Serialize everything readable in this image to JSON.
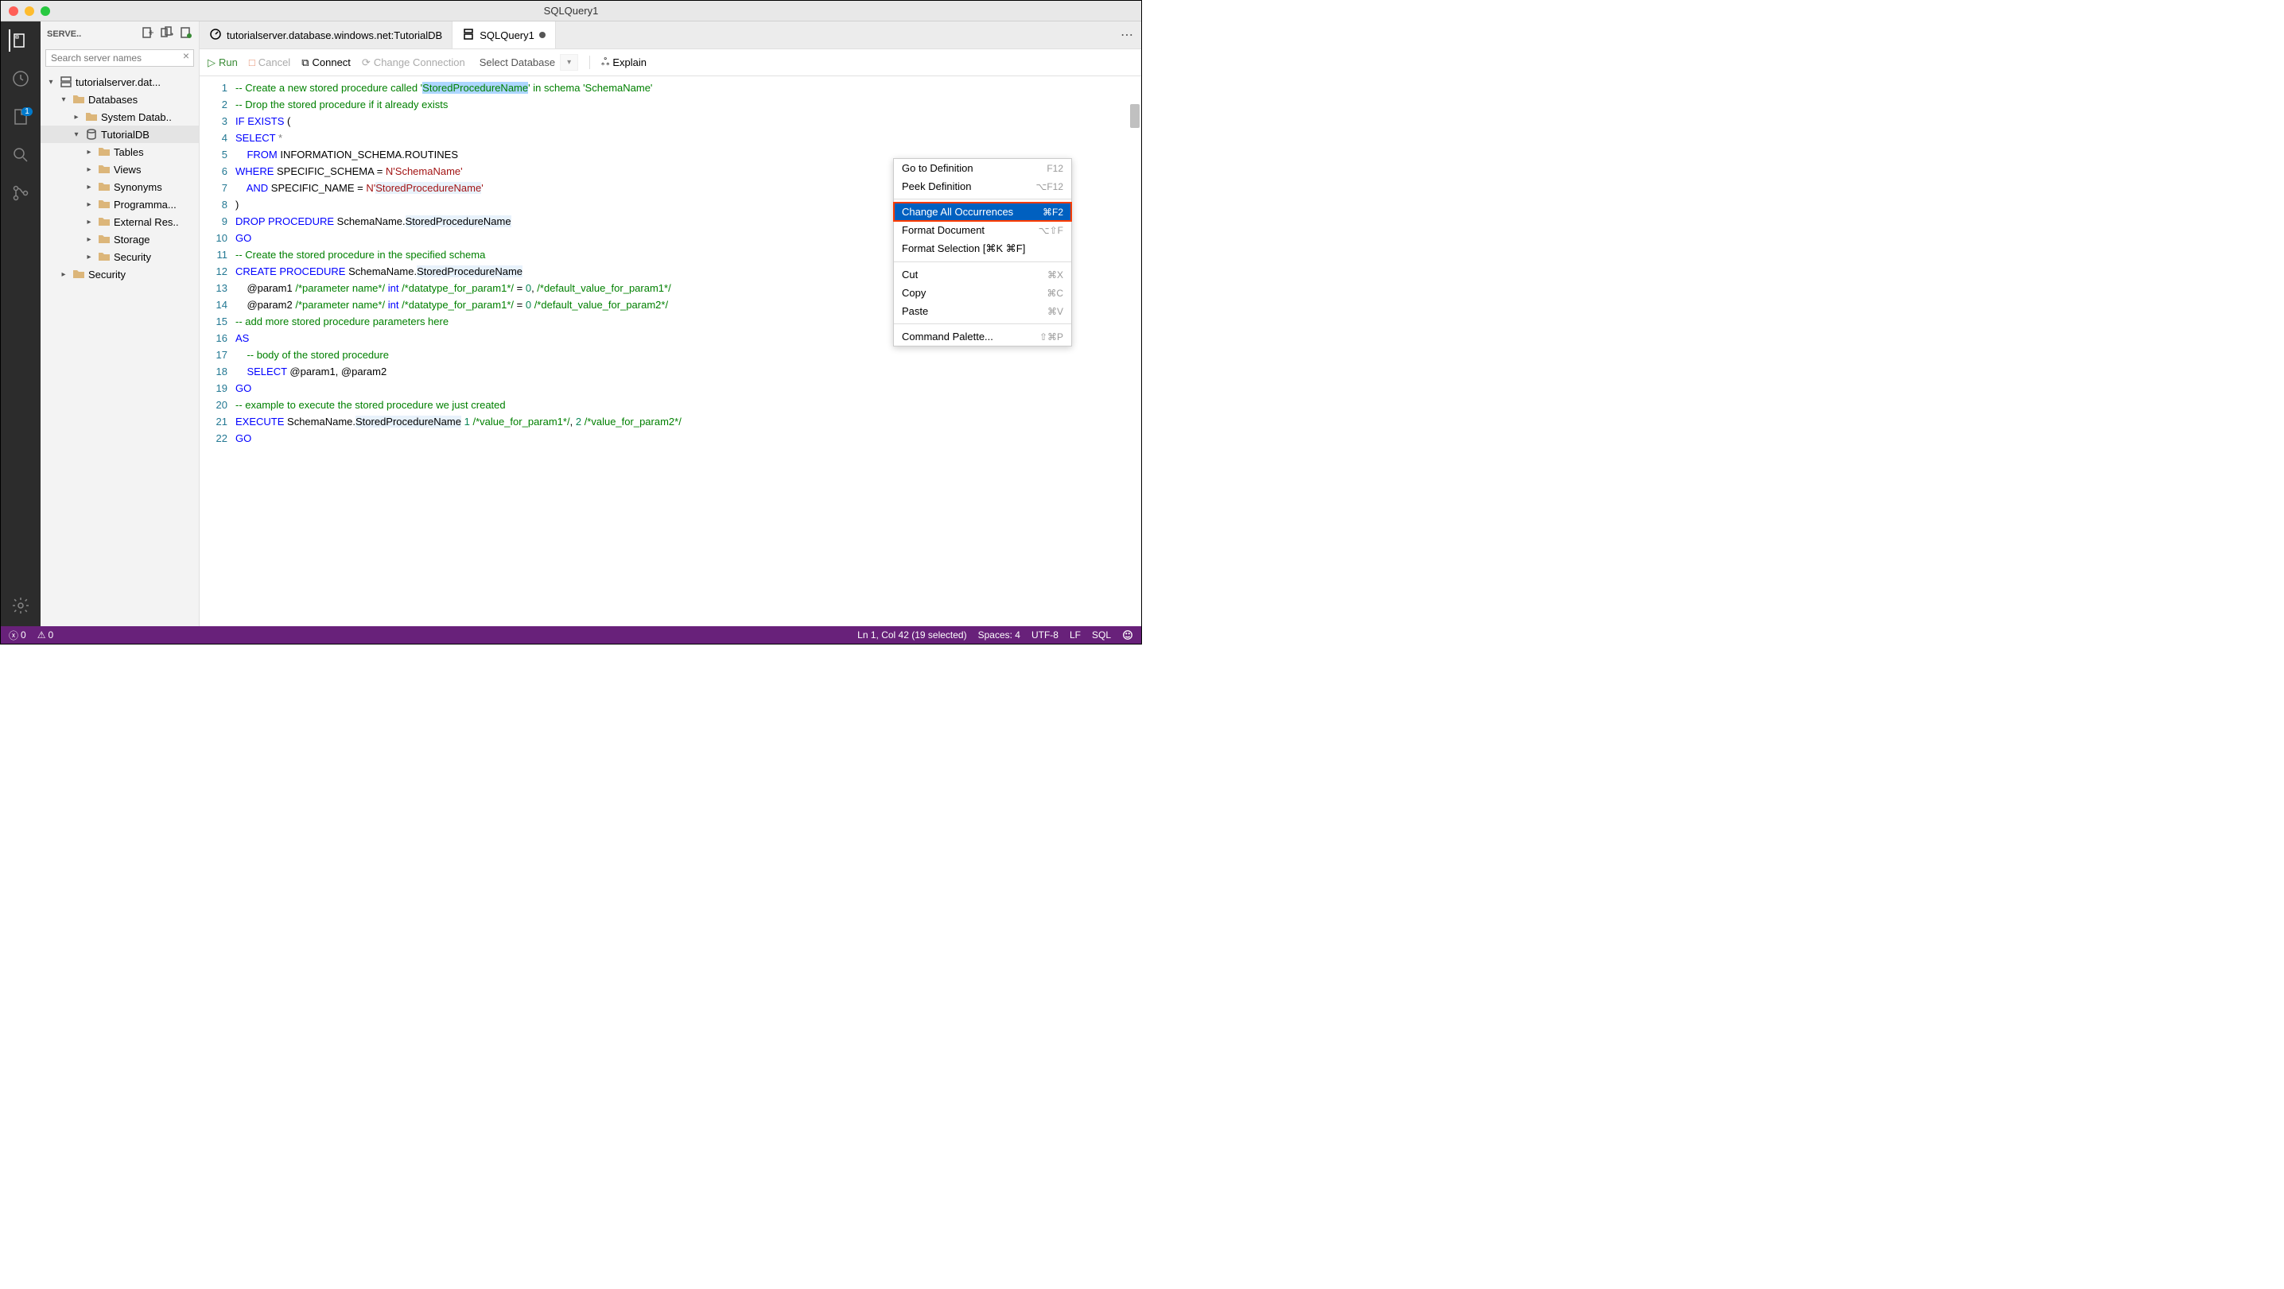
{
  "window": {
    "title": "SQLQuery1"
  },
  "activitybar": {
    "badge": "1"
  },
  "sidebar": {
    "title": "SERVE..",
    "search_placeholder": "Search server names",
    "tree": {
      "server": "tutorialserver.dat...",
      "databases": "Databases",
      "sysdb": "System Datab..",
      "tutdb": "TutorialDB",
      "tables": "Tables",
      "views": "Views",
      "synonyms": "Synonyms",
      "program": "Programma...",
      "extres": "External Res..",
      "storage": "Storage",
      "security_inner": "Security",
      "security": "Security"
    }
  },
  "tabs": {
    "t0": "tutorialserver.database.windows.net:TutorialDB",
    "t1": "SQLQuery1"
  },
  "toolbar": {
    "run": "Run",
    "cancel": "Cancel",
    "connect": "Connect",
    "change_conn": "Change Connection",
    "select_db": "Select Database",
    "explain": "Explain"
  },
  "context_menu": {
    "goto_def": "Go to Definition",
    "goto_def_sc": "F12",
    "peek_def": "Peek Definition",
    "peek_def_sc": "⌥F12",
    "change_all": "Change All Occurrences",
    "change_all_sc": "⌘F2",
    "fmt_doc": "Format Document",
    "fmt_doc_sc": "⌥⇧F",
    "fmt_sel": "Format Selection [⌘K ⌘F]",
    "cut": "Cut",
    "cut_sc": "⌘X",
    "copy": "Copy",
    "copy_sc": "⌘C",
    "paste": "Paste",
    "paste_sc": "⌘V",
    "cmd_pal": "Command Palette...",
    "cmd_pal_sc": "⇧⌘P"
  },
  "editor": {
    "lines": [
      {
        "n": "1",
        "html": "<span class='c-comment'>-- Create a new stored procedure called '<span class='hl'>StoredProcedureName</span>' in schema 'SchemaName'</span>"
      },
      {
        "n": "2",
        "html": "<span class='c-comment'>-- Drop the stored procedure if it already exists</span>"
      },
      {
        "n": "3",
        "html": "<span class='c-kw'>IF</span> <span class='c-kw'>EXISTS</span> ("
      },
      {
        "n": "4",
        "html": "<span class='c-kw'>SELECT</span> <span class='c-op'>*</span>"
      },
      {
        "n": "5",
        "html": "    <span class='c-kw'>FROM</span> INFORMATION_SCHEMA.ROUTINES"
      },
      {
        "n": "6",
        "html": "<span class='c-kw'>WHERE</span> SPECIFIC_SCHEMA = <span class='c-str'>N'SchemaName'</span>"
      },
      {
        "n": "7",
        "html": "    <span class='c-kw'>AND</span> SPECIFIC_NAME = <span class='c-str'>N'<span class='hl-light'>StoredProcedureName</span>'</span>"
      },
      {
        "n": "8",
        "html": ")"
      },
      {
        "n": "9",
        "html": "<span class='c-kw'>DROP</span> <span class='c-kw'>PROCEDURE</span> SchemaName.<span class='hl-light'>StoredProcedureName</span>"
      },
      {
        "n": "10",
        "html": "<span class='c-kw'>GO</span>"
      },
      {
        "n": "11",
        "html": "<span class='c-comment'>-- Create the stored procedure in the specified schema</span>"
      },
      {
        "n": "12",
        "html": "<span class='c-kw'>CREATE</span> <span class='c-kw'>PROCEDURE</span> SchemaName.<span class='hl-light'>StoredProcedureName</span>"
      },
      {
        "n": "13",
        "html": "    @param1 <span class='c-comment'>/*parameter name*/</span> <span class='c-kw'>int</span> <span class='c-comment'>/*datatype_for_param1*/</span> = <span class='c-num'>0</span>, <span class='c-comment'>/*default_value_for_param1*/</span>"
      },
      {
        "n": "14",
        "html": "    @param2 <span class='c-comment'>/*parameter name*/</span> <span class='c-kw'>int</span> <span class='c-comment'>/*datatype_for_param1*/</span> = <span class='c-num'>0</span> <span class='c-comment'>/*default_value_for_param2*/</span>"
      },
      {
        "n": "15",
        "html": "<span class='c-comment'>-- add more stored procedure parameters here</span>"
      },
      {
        "n": "16",
        "html": "<span class='c-kw'>AS</span>"
      },
      {
        "n": "17",
        "html": "    <span class='c-comment'>-- body of the stored procedure</span>"
      },
      {
        "n": "18",
        "html": "    <span class='c-kw'>SELECT</span> @param1, @param2"
      },
      {
        "n": "19",
        "html": "<span class='c-kw'>GO</span>"
      },
      {
        "n": "20",
        "html": "<span class='c-comment'>-- example to execute the stored procedure we just created</span>"
      },
      {
        "n": "21",
        "html": "<span class='c-kw'>EXECUTE</span> SchemaName.<span class='hl-light'>StoredProcedureName</span> <span class='c-num'>1</span> <span class='c-comment'>/*value_for_param1*/</span>, <span class='c-num'>2</span> <span class='c-comment'>/*value_for_param2*/</span>"
      },
      {
        "n": "22",
        "html": "<span class='c-kw'>GO</span>"
      }
    ]
  },
  "statusbar": {
    "errors": "0",
    "warnings": "0",
    "ln_col": "Ln 1, Col 42 (19 selected)",
    "spaces": "Spaces: 4",
    "encoding": "UTF-8",
    "eol": "LF",
    "lang": "SQL"
  }
}
